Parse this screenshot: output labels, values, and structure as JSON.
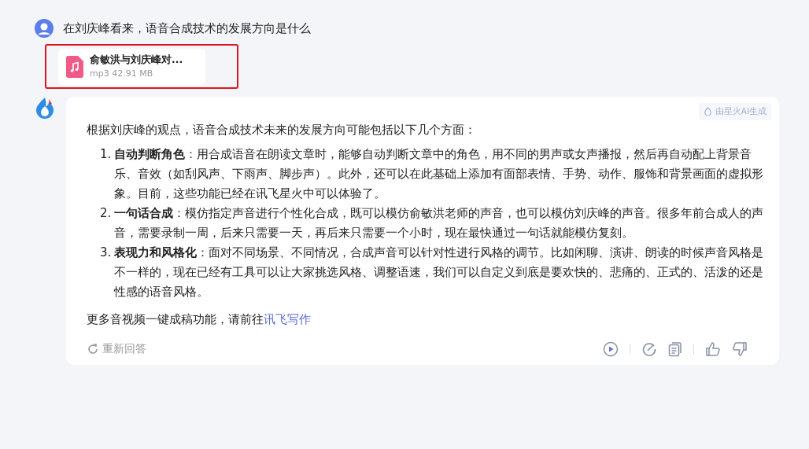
{
  "question": {
    "text": "在刘庆峰看来，语音合成技术的发展方向是什么"
  },
  "attachment": {
    "name": "俞敏洪与刘庆峰对...",
    "meta": "mp3 42.91 MB",
    "highlighted": true
  },
  "answer": {
    "badge": "由星火AI生成",
    "intro": "根据刘庆峰的观点，语音合成技术未来的发展方向可能包括以下几个方面：",
    "items": [
      {
        "number": "1.",
        "text": "**自动判断角色**：用合成语音在朗读文章时，能够自动判断文章中的角色，用不同的男声或女声播报，然后再自动配上背景音乐、音效（如刮风声、下雨声、脚步声）。此外，还可以在此基础上添加有面部表情、手势、动作、服饰和背景画面的虚拟形象。目前，这些功能已经在讯飞星火中可以体验了。"
      },
      {
        "number": "2.",
        "text": "**一句话合成**：模仿指定声音进行个性化合成，既可以模仿俞敏洪老师的声音，也可以模仿刘庆峰的声音。很多年前合成人的声音，需要录制一周，后来只需要一天，再后来只需要一个小时，现在最快通过一句话就能模仿复刻。"
      },
      {
        "number": "3.",
        "text": "**表现力和风格化**：面对不同场景、不同情况，合成声音可以针对性进行风格的调节。比如闲聊、演讲、朗读的时候声音风格是不一样的，现在已经有工具可以让大家挑选风格、调整语速，我们可以自定义到底是要欢快的、悲痛的、正式的、活泼的还是性感的语音风格。"
      }
    ],
    "footer_text": "更多音视频一键成稿功能，请前往",
    "footer_link": "讯飞写作",
    "regenerate": "重新回答"
  }
}
